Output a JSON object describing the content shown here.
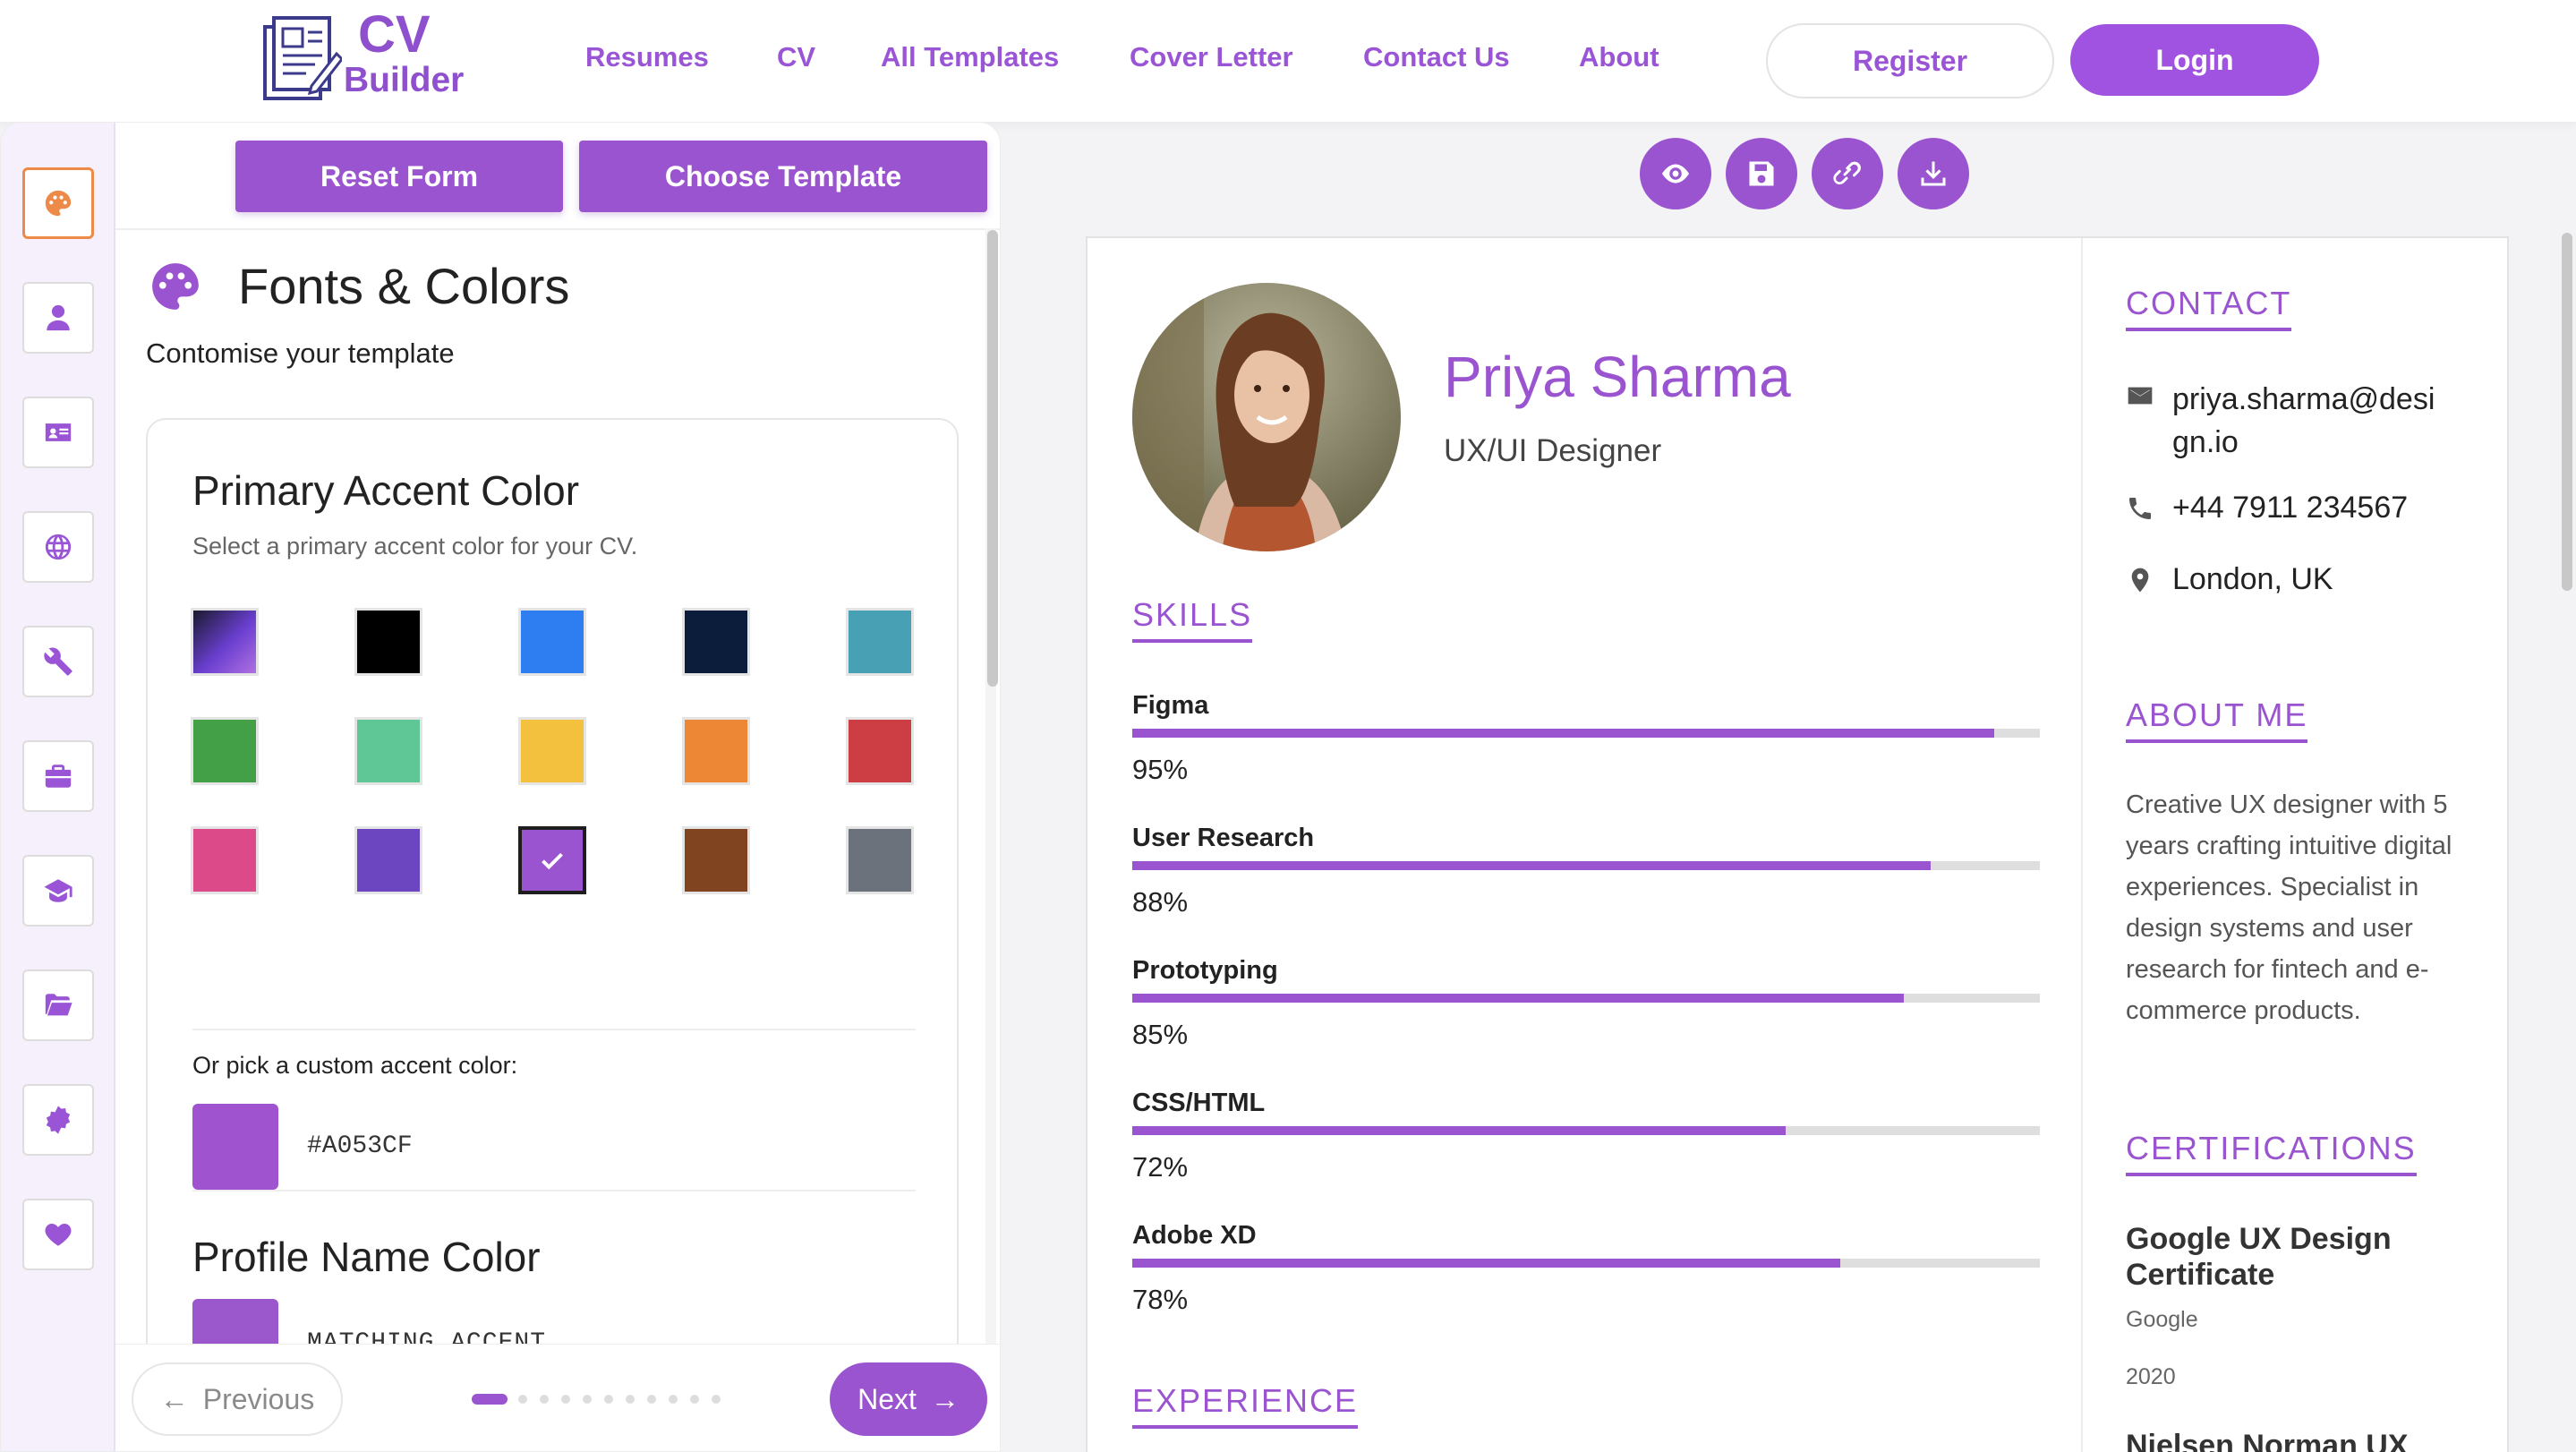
{
  "brand": {
    "line1": "CV",
    "line2": "Builder"
  },
  "nav": [
    "Resumes",
    "CV",
    "All Templates",
    "Cover Letter",
    "Contact Us",
    "About"
  ],
  "auth": {
    "register": "Register",
    "login": "Login"
  },
  "rail": [
    "palette-icon",
    "user-icon",
    "id-card-icon",
    "globe-icon",
    "wrench-icon",
    "briefcase-icon",
    "graduation-cap-icon",
    "folder-icon",
    "badge-icon",
    "heart-icon"
  ],
  "actions": {
    "reset": "Reset Form",
    "choose_template": "Choose Template"
  },
  "section": {
    "title": "Fonts & Colors",
    "subtitle": "Contomise your template"
  },
  "primary_color": {
    "title": "Primary Accent Color",
    "subtitle": "Select a primary accent color for your CV.",
    "swatches": [
      "gradient",
      "#000000",
      "#2e7ef2",
      "#0b1d3a",
      "#48a0b4",
      "#43a047",
      "#5fc796",
      "#f4c13e",
      "#ee8735",
      "#cc3d44",
      "#dc4a8a",
      "#6c46c0",
      "#9a54d0",
      "#804520",
      "#6b727b"
    ],
    "selected_index": 12,
    "custom_label": "Or pick a custom accent color:",
    "custom_value": "#A053CF"
  },
  "profile_name_color": {
    "title": "Profile Name Color",
    "value": "MATCHING ACCENT"
  },
  "footer": {
    "previous": "Previous",
    "next": "Next",
    "steps_total": 11,
    "current_step": 1
  },
  "toolbar": [
    "eye-icon",
    "save-icon",
    "link-icon",
    "download-icon"
  ],
  "cv": {
    "name": "Priya Sharma",
    "role": "UX/UI Designer",
    "skills_heading": "SKILLS",
    "skills": [
      {
        "name": "Figma",
        "level": 95,
        "label": "95%"
      },
      {
        "name": "User Research",
        "level": 88,
        "label": "88%"
      },
      {
        "name": "Prototyping",
        "level": 85,
        "label": "85%"
      },
      {
        "name": "CSS/HTML",
        "level": 72,
        "label": "72%"
      },
      {
        "name": "Adobe XD",
        "level": 78,
        "label": "78%"
      }
    ],
    "experience_heading": "EXPERIENCE",
    "contact_heading": "CONTACT",
    "email_line1": "priya.sharma@desi",
    "email_line2": "gn.io",
    "phone": "+44 7911 234567",
    "location": "London, UK",
    "about_heading": "ABOUT ME",
    "about": "Creative UX designer with 5 years crafting intuitive digital experiences. Specialist in design systems and user research for fintech and e-commerce products.",
    "cert_heading": "CERTIFICATIONS",
    "cert_name": "Google UX Design Certificate",
    "cert_org": "Google",
    "cert_year": "2020",
    "cert2_name": "Nielsen Norman UX"
  }
}
